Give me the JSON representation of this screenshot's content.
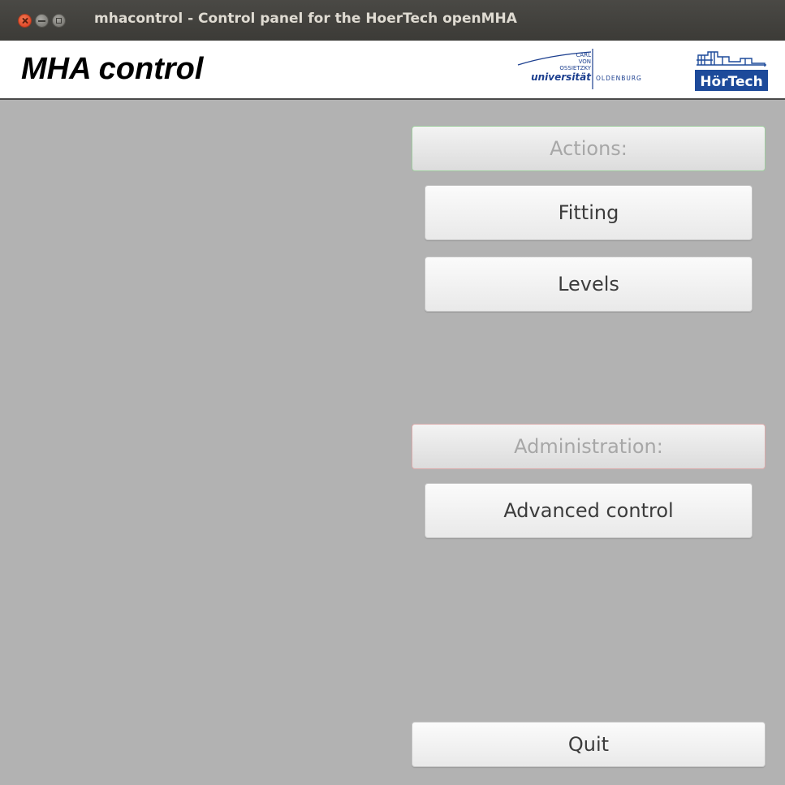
{
  "window": {
    "title": "mhacontrol - Control panel for the HoerTech openMHA"
  },
  "header": {
    "app_title": "MHA control",
    "university_logo": {
      "line1": "CARL",
      "line2": "VON",
      "line3": "OSSIETZKY",
      "word1": "universität",
      "word2": "OLDENBURG"
    },
    "hoertech_logo": {
      "text": "HörTech"
    }
  },
  "actions": {
    "label": "Actions:",
    "fitting_label": "Fitting",
    "levels_label": "Levels"
  },
  "administration": {
    "label": "Administration:",
    "advanced_label": "Advanced control"
  },
  "quit_label": "Quit",
  "colors": {
    "background": "#b2b2b2",
    "titlebar": "#3c3b37",
    "uni_blue": "#1c3f8f",
    "hoertech_blue": "#1d4a9a"
  }
}
